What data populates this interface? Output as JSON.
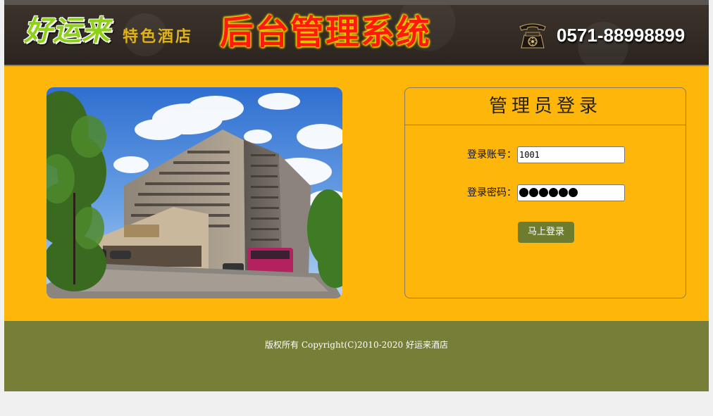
{
  "header": {
    "brand_name": "好运来",
    "brand_sub": "特色酒店",
    "system_title": "后台管理系统",
    "phone_icon": "telephone-icon",
    "phone_number": "0571-88998899"
  },
  "main": {
    "hotel_photo": "hotel-building-photo",
    "login": {
      "title": "管理员登录",
      "account_label": "登录账号：",
      "account_value": "1001",
      "password_label": "登录密码：",
      "password_length": 6,
      "submit_label": "马上登录"
    }
  },
  "footer": {
    "copyright": "版权所有 Copyright(C)2010-2020 好运来酒店"
  },
  "colors": {
    "header_bg": "#2b241f",
    "main_bg": "#ffb60b",
    "footer_bg": "#767e37",
    "button_bg": "#6e7c30",
    "title_red": "#ff1a0d",
    "brand_green": "#8ed11b"
  }
}
